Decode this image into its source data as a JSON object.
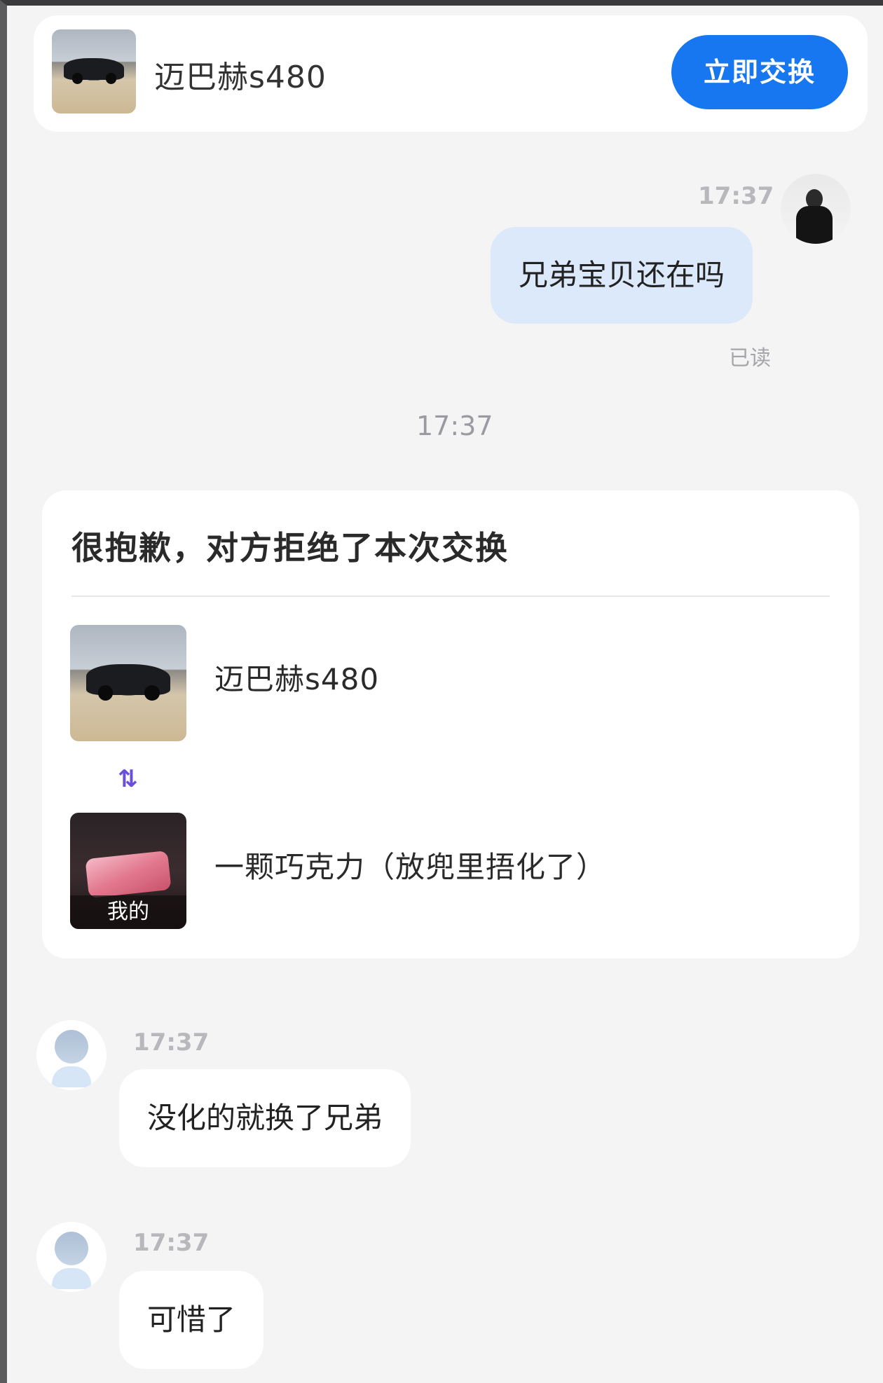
{
  "product_card": {
    "title": "迈巴赫s480",
    "swap_button_label": "立即交换"
  },
  "messages": {
    "m1": {
      "time": "17:37",
      "text": "兄弟宝贝还在吗",
      "status": "已读"
    },
    "center_time": "17:37",
    "m2": {
      "time": "17:37",
      "text": "没化的就换了兄弟"
    },
    "m3": {
      "time": "17:37",
      "text": "可惜了"
    }
  },
  "exchange_result": {
    "title": "很抱歉，对方拒绝了本次交换",
    "their_item": "迈巴赫s480",
    "swap_icon": "⇅",
    "my_item": "一颗巧克力（放兜里捂化了）",
    "my_item_tag": "我的"
  },
  "colors": {
    "accent": "#1677f0",
    "my_bubble": "#dce9fb",
    "swap_icon": "#6a4fdc"
  }
}
